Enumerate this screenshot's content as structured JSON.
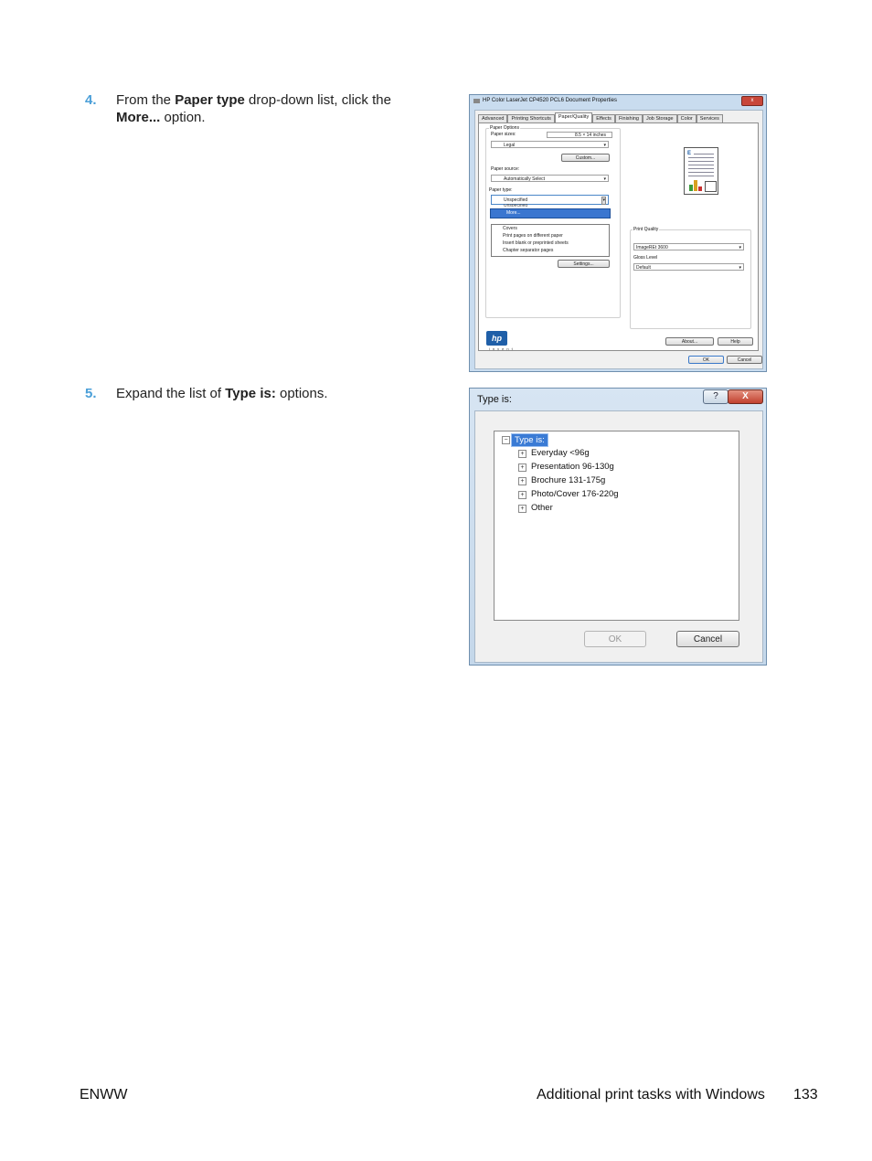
{
  "steps": [
    {
      "number": "4.",
      "pre": "From the ",
      "b1": "Paper type",
      "mid": " drop-down list, click the ",
      "b2": "More...",
      "post": " option."
    },
    {
      "number": "5.",
      "pre": "Expand the list of ",
      "b1": "Type is:",
      "post": " options."
    }
  ],
  "dialog1": {
    "title": "HP Color LaserJet CP4520 PCL6 Document Properties",
    "close": "x",
    "tabs": [
      "Advanced",
      "Printing Shortcuts",
      "Paper/Quality",
      "Effects",
      "Finishing",
      "Job Storage",
      "Color",
      "Services"
    ],
    "paper_options_label": "Paper Options",
    "paper_sizes_label": "Paper sizes:",
    "paper_size_dim": "8.5 × 14 inches",
    "paper_size_value": "Legal",
    "custom_button": "Custom...",
    "paper_source_label": "Paper source:",
    "paper_source_value": "Automatically Select",
    "paper_type_label": "Paper type:",
    "paper_type_value": "Unspecified",
    "dropdown_partial": "Unspecified",
    "dropdown_selected": "More...",
    "special_pages": [
      "Covers",
      "Print pages on different paper",
      "Insert blank or preprinted sheets",
      "Chapter separator pages"
    ],
    "settings_button": "Settings...",
    "print_quality_label": "Print Quality",
    "print_quality_value": "ImageREt 3600",
    "gloss_level_label": "Gloss Level",
    "gloss_level_value": "Default",
    "hp_logo": "hp",
    "invent": "invent",
    "about_button": "About...",
    "help_button": "Help",
    "ok_button": "OK",
    "cancel_button": "Cancel"
  },
  "dialog2": {
    "title": "Type is:",
    "help": "?",
    "close": "X",
    "root": "Type is:",
    "items": [
      "Everyday <96g",
      "Presentation 96-130g",
      "Brochure 131-175g",
      "Photo/Cover 176-220g",
      "Other"
    ],
    "ok_button": "OK",
    "cancel_button": "Cancel"
  },
  "footer": {
    "left": "ENWW",
    "section": "Additional print tasks with Windows",
    "page": "133"
  }
}
